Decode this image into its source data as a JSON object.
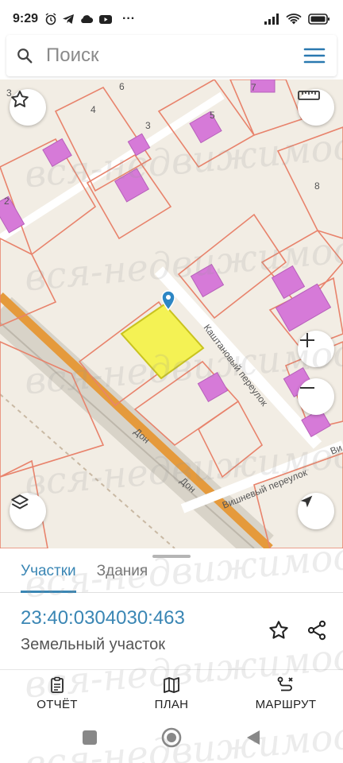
{
  "status_bar": {
    "time": "9:29",
    "dots": "···"
  },
  "search": {
    "placeholder": "Поиск"
  },
  "map": {
    "street_labels": [
      {
        "text": "Каштановый переулок"
      },
      {
        "text": "Вишневый переулок"
      },
      {
        "text": "Дон"
      },
      {
        "text": "Дон"
      },
      {
        "text": "Ви"
      }
    ],
    "house_numbers": [
      "6",
      "3",
      "4",
      "5",
      "3",
      "2",
      "8",
      "7"
    ],
    "colors": {
      "background": "#f2ede4",
      "parcel_border": "#e8836c",
      "building": "#d67ad8",
      "selected_parcel": "#f4f254",
      "road_orange": "#e59a3c",
      "marker": "#2c86c4"
    }
  },
  "sheet": {
    "tabs": [
      {
        "label": "Участки",
        "active": true
      },
      {
        "label": "Здания",
        "active": false
      }
    ],
    "parcel_number": "23:40:0304030:463",
    "parcel_type": "Земельный участок"
  },
  "bottom_nav": [
    {
      "label": "ОТЧЁТ",
      "icon": "report-icon"
    },
    {
      "label": "ПЛАН",
      "icon": "map-plan-icon"
    },
    {
      "label": "МАРШРУТ",
      "icon": "route-icon"
    }
  ],
  "watermark": "вся-недвижимость.рф"
}
